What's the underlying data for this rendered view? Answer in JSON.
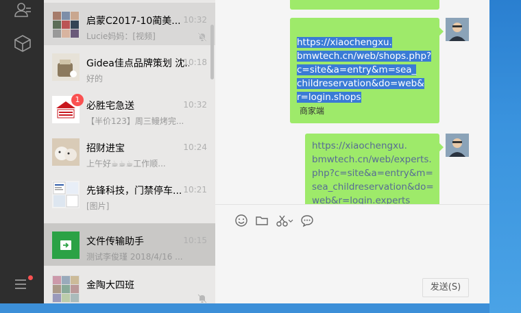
{
  "chats": [
    {
      "name": "启蒙C2017-10蔺美...",
      "time": "10:32",
      "preview": "Lucie妈妈：[视频]",
      "muted": true
    },
    {
      "name": "Gidea佳点品牌策划 沈...",
      "time": "10:18",
      "preview": "好的",
      "muted": false
    },
    {
      "name": "必胜宅急送",
      "time": "10:32",
      "preview": "【半价123】周三鳗烤完...",
      "muted": false,
      "badge": "1"
    },
    {
      "name": "招财进宝",
      "time": "10:24",
      "preview": "上午好☕☕☕工作顺...",
      "muted": false
    },
    {
      "name": "先锋科技，门禁停车...",
      "time": "10:21",
      "preview": "[图片]",
      "muted": false
    },
    {
      "name": "文件传输助手",
      "time": "10:15",
      "preview": "测试李俊瑾  2018/4/16 ...",
      "muted": false
    },
    {
      "name": "金陶大四班",
      "time": "",
      "preview": "",
      "muted": true
    }
  ],
  "messages": {
    "msg1_lines": [
      "https://xiaochengxu.",
      "bmwtech.cn/web/shops.php?",
      "c=site&a=entry&m=sea_",
      "childreservation&do=web&",
      "r=login.shops"
    ],
    "msg1_caption": "商家端",
    "msg2_lines": [
      "https://xiaochengxu.",
      "bmwtech.cn/web/experts.",
      "php?c=site&a=entry&m=",
      "sea_childreservation&do=",
      "web&r=login.experts"
    ]
  },
  "composer": {
    "send_label": "发送(S)"
  },
  "icons": [
    "contacts-icon",
    "collections-icon",
    "menu-icon",
    "emoji-icon",
    "folder-icon",
    "scissors-icon",
    "chat-history-icon"
  ],
  "colors": {
    "bubble": "#9eea6a",
    "link": "#576b95",
    "selection": "#3a7bd5",
    "badge": "#fa5151"
  }
}
